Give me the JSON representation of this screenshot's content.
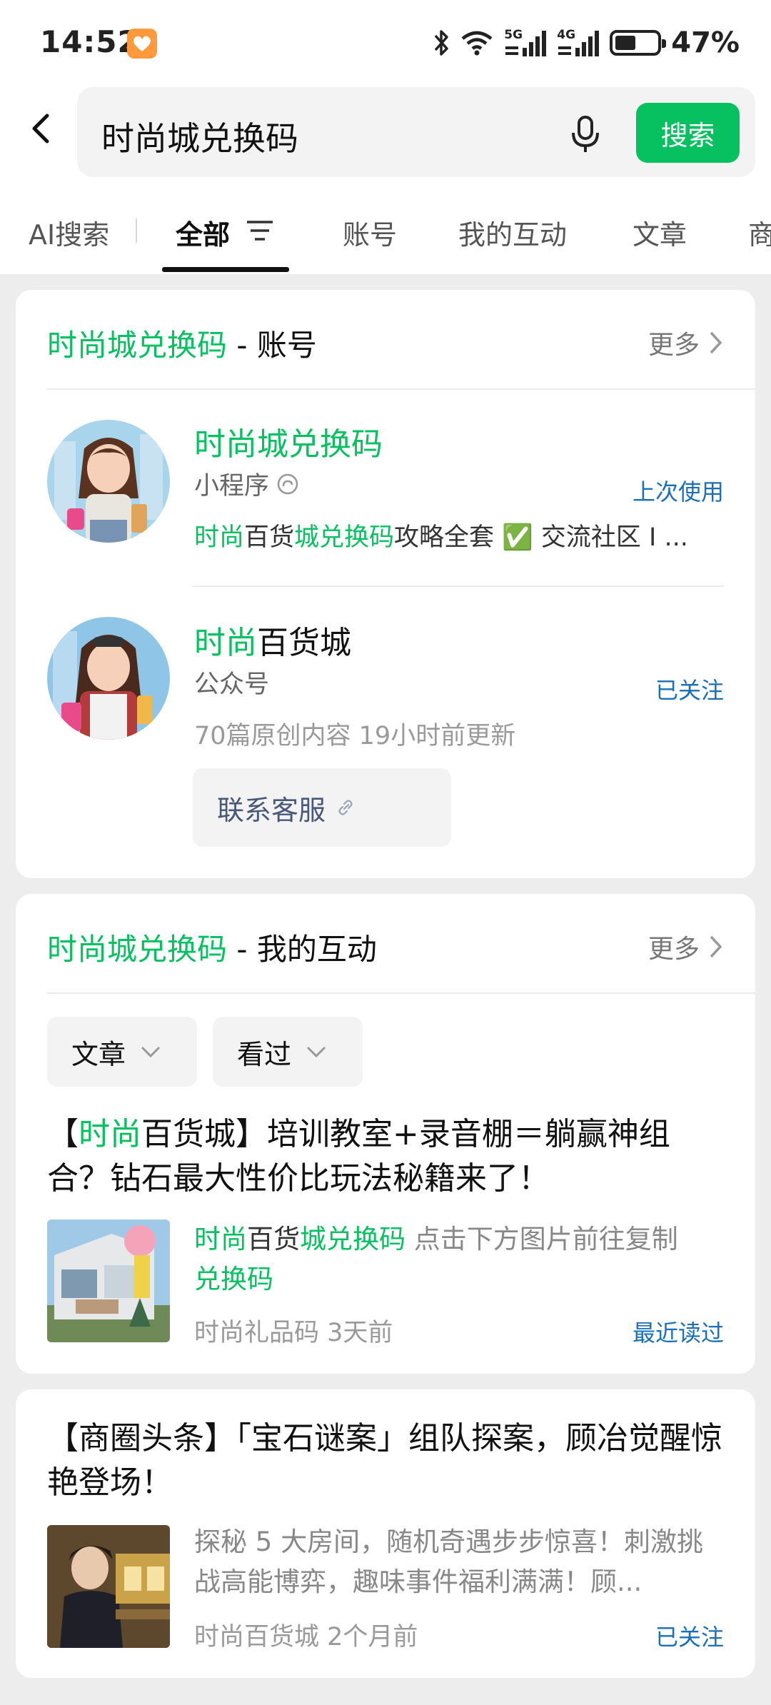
{
  "status_bar": {
    "time": "14:52",
    "signal_1": "5G",
    "signal_2": "4G",
    "battery": "47%"
  },
  "search": {
    "query": "时尚城兑换码",
    "button_label": "搜索"
  },
  "tabs": [
    {
      "label": "AI搜索"
    },
    {
      "label": "全部"
    },
    {
      "label": "账号"
    },
    {
      "label": "我的互动"
    },
    {
      "label": "文章"
    },
    {
      "label": "商"
    }
  ],
  "accounts_section": {
    "title_keyword": "时尚城兑换码",
    "title_suffix": " - 账号",
    "more_label": "更多",
    "items": [
      {
        "name": "时尚城兑换码",
        "type": "小程序",
        "status": "上次使用",
        "desc_parts": [
          "时尚",
          "百货",
          "城兑换码",
          "攻略全套 ✅ 交流社区 I ..."
        ]
      },
      {
        "name_parts": [
          "时尚",
          "百货城"
        ],
        "type": "公众号",
        "status": "已关注",
        "meta": "70篇原创内容  19小时前更新",
        "action_label": "联系客服"
      }
    ]
  },
  "interactions_section": {
    "title_keyword": "时尚城兑换码",
    "title_suffix": " - 我的互动",
    "more_label": "更多",
    "filters": [
      "文章",
      "看过"
    ],
    "article": {
      "title_parts": [
        "【",
        "时尚",
        "百货城】培训教室+录音棚＝躺赢神组合？钻石最大性价比玩法秘籍来了！"
      ],
      "body_parts": [
        "时尚",
        "百货",
        "城兑换码",
        " 点击下方图片前往复制",
        "兑换码"
      ],
      "source": "时尚礼品码",
      "time": "3天前",
      "status": "最近读过"
    }
  },
  "article_card": {
    "title": "【商圈头条】「宝石谜案」组队探案，顾冶觉醒惊艳登场！",
    "body": "探秘 5 大房间，随机奇遇步步惊喜！刺激挑战高能博弈，趣味事件福利满满！顾...",
    "source": "时尚百货城",
    "time": "2个月前",
    "status": "已关注"
  },
  "colors": {
    "accent_green": "#07c160",
    "link_blue": "#1a6fb8",
    "background": "#ededed"
  }
}
